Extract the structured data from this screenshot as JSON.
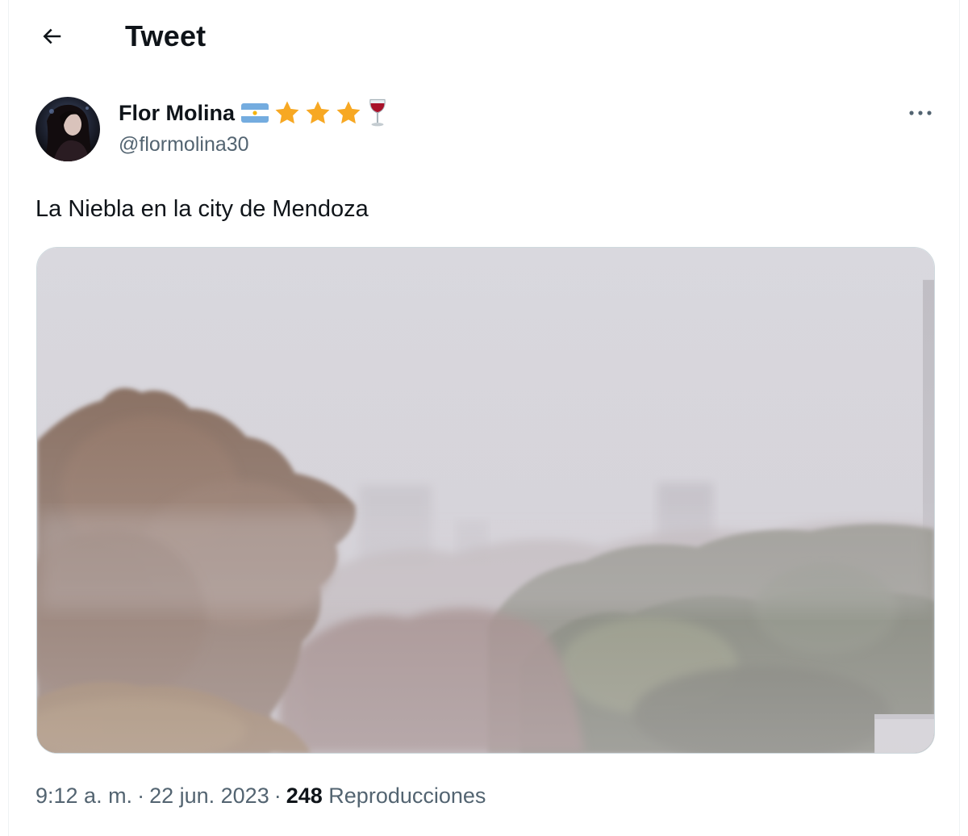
{
  "header": {
    "title": "Tweet",
    "back_icon": "arrow-left-icon"
  },
  "author": {
    "name": "Flor Molina",
    "handle": "@flormolina30",
    "name_emojis": [
      "argentina-flag-icon",
      "star-icon",
      "star-icon",
      "star-icon",
      "wine-glass-icon"
    ],
    "more_icon": "more-horizontal-icon"
  },
  "tweet": {
    "text": "La Niebla en la city de Mendoza"
  },
  "meta": {
    "time": "9:12 a. m.",
    "separator": "·",
    "date": "22 jun. 2023",
    "views_count": "248",
    "views_label": "Reproducciones"
  },
  "colors": {
    "text_primary": "#0f1419",
    "text_secondary": "#536471",
    "border": "#eff3f4",
    "star": "#f7a823"
  }
}
